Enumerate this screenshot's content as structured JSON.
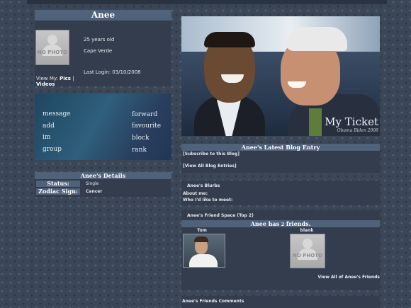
{
  "profile": {
    "name": "Anee",
    "age": "25 years old",
    "location": "Cape Verde",
    "view_my_label": "View My:",
    "pics_link": "Pics",
    "separator": "|",
    "videos_link": "Videos",
    "last_login": "Last Login: 03/10/2008",
    "photo_placeholder": "NO PHOTO"
  },
  "contact": {
    "message": "message",
    "forward": "forward",
    "add": "add",
    "favourite": "favourite",
    "im": "im",
    "block": "block",
    "group": "group",
    "rank": "rank"
  },
  "details": {
    "title": "Anee's Details",
    "rows": [
      {
        "label": "Status:",
        "value": "Single"
      },
      {
        "label": "Zodiac Sign:",
        "value": "Cancer"
      }
    ]
  },
  "banner": {
    "caption": "My Ticket",
    "credit": "Obama Biden 2008"
  },
  "blog": {
    "title": "Anee's Latest Blog Entry",
    "subscribe": "[Subscribe to this Blog]",
    "view_all": "[View All Blog Entries]"
  },
  "blurbs": {
    "title": "Anee's Blurbs",
    "about_me": "About me:",
    "meet": "Who I'd like to meet:"
  },
  "friends": {
    "title": "Anee's Friend Space (Top 2)",
    "count_prefix": "Anee has ",
    "count": "2",
    "count_suffix": " friends.",
    "items": [
      {
        "name": "Tom"
      },
      {
        "name": "blank"
      }
    ],
    "view_all": "View All of Anee's Friends"
  },
  "comments": {
    "title": "Anee's Friends Comments"
  },
  "colors": {
    "page_bg": "#3b4657",
    "panel_bg": "#333d4d",
    "header_bg": "#50617a"
  }
}
